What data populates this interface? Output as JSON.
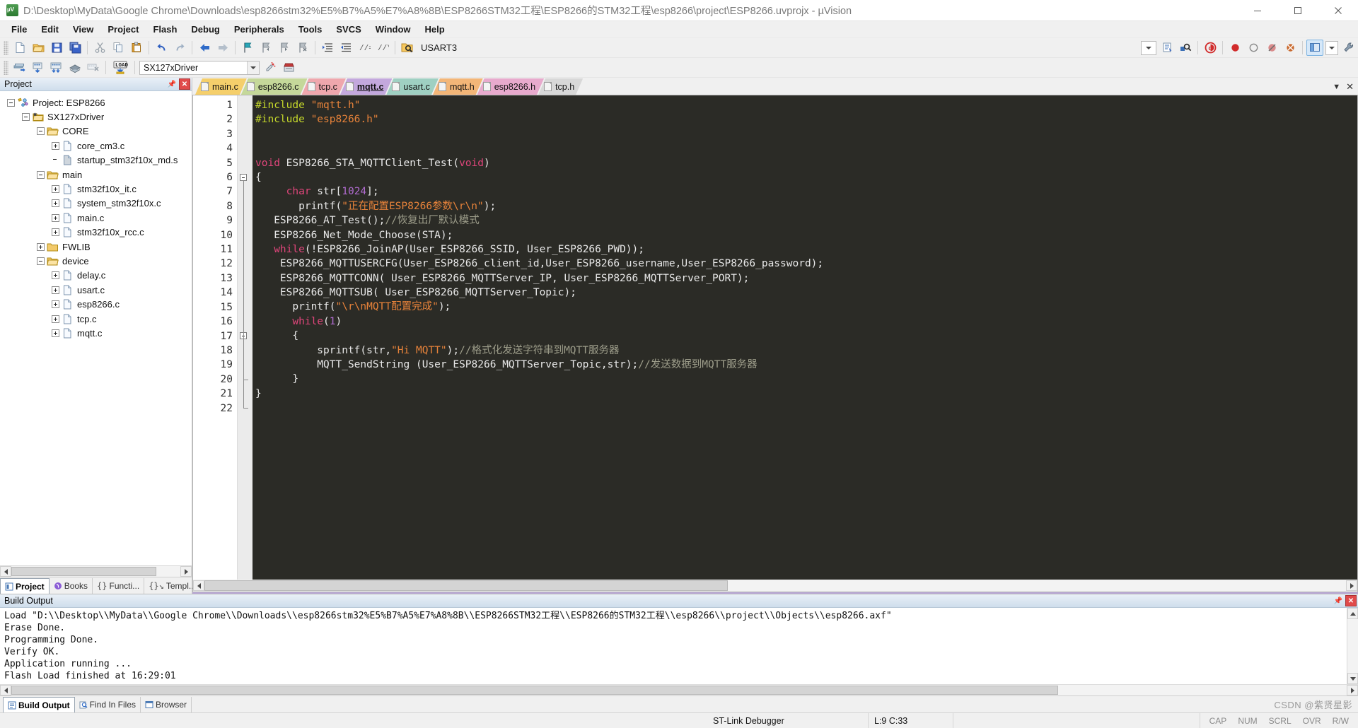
{
  "window": {
    "title": "D:\\Desktop\\MyData\\Google Chrome\\Downloads\\esp8266stm32%E5%B7%A5%E7%A8%8B\\ESP8266STM32工程\\ESP8266的STM32工程\\esp8266\\project\\ESP8266.uvprojx - µVision",
    "app_icon": "uvision-logo",
    "minimize": "─",
    "maximize": "☐",
    "close": "✕"
  },
  "menubar": {
    "items": [
      {
        "label": "File"
      },
      {
        "label": "Edit"
      },
      {
        "label": "View"
      },
      {
        "label": "Project"
      },
      {
        "label": "Flash"
      },
      {
        "label": "Debug"
      },
      {
        "label": "Peripherals"
      },
      {
        "label": "Tools"
      },
      {
        "label": "SVCS"
      },
      {
        "label": "Window"
      },
      {
        "label": "Help"
      }
    ]
  },
  "toolbar_main": {
    "find_combo_value": "USART3",
    "icons": [
      "new-file-icon",
      "open-file-icon",
      "save-icon",
      "save-all-icon",
      "cut-icon",
      "copy-icon",
      "paste-icon",
      "undo-icon",
      "redo-icon",
      "navigate-back-icon",
      "navigate-forward-icon",
      "bookmark-toggle-icon",
      "bookmark-prev-icon",
      "bookmark-next-icon",
      "bookmark-clear-icon",
      "indent-increase-icon",
      "indent-decrease-icon",
      "comment-selection-icon",
      "uncomment-selection-icon",
      "find-in-files-icon",
      "insert-bookmark-icon",
      "show-output-icon",
      "find-icon",
      "debug-session-icon",
      "breakpoint-icon",
      "disable-breakpoint-icon",
      "disable-all-breakpoints-icon",
      "kill-all-breakpoints-icon",
      "window-layout-icon",
      "configure-icon"
    ]
  },
  "toolbar_build": {
    "target_value": "SX127xDriver",
    "icons": [
      "translate-file-icon",
      "build-target-icon",
      "rebuild-all-icon",
      "batch-build-icon",
      "stop-build-icon",
      "download-to-flash-icon",
      "target-options-icon",
      "manage-runtime-icon"
    ],
    "download_label": "LOAD"
  },
  "sidebar": {
    "caption": "Project",
    "caption_buttons": [
      "pin-icon",
      "close-icon"
    ],
    "tree": [
      {
        "label": "Project: ESP8266",
        "depth": 0,
        "expander": "minus",
        "icon": "project-icon"
      },
      {
        "label": "SX127xDriver",
        "depth": 1,
        "expander": "minus",
        "icon": "target-icon"
      },
      {
        "label": "CORE",
        "depth": 2,
        "expander": "minus",
        "icon": "folder-open-icon"
      },
      {
        "label": "core_cm3.c",
        "depth": 3,
        "expander": "plus",
        "icon": "c-file-icon"
      },
      {
        "label": "startup_stm32f10x_md.s",
        "depth": 3,
        "expander": "none",
        "icon": "asm-file-icon"
      },
      {
        "label": "main",
        "depth": 2,
        "expander": "minus",
        "icon": "folder-open-icon"
      },
      {
        "label": "stm32f10x_it.c",
        "depth": 3,
        "expander": "plus",
        "icon": "c-file-icon"
      },
      {
        "label": "system_stm32f10x.c",
        "depth": 3,
        "expander": "plus",
        "icon": "c-file-icon"
      },
      {
        "label": "main.c",
        "depth": 3,
        "expander": "plus",
        "icon": "c-file-icon"
      },
      {
        "label": "stm32f10x_rcc.c",
        "depth": 3,
        "expander": "plus",
        "icon": "c-file-icon"
      },
      {
        "label": "FWLIB",
        "depth": 2,
        "expander": "plus",
        "icon": "folder-closed-icon"
      },
      {
        "label": "device",
        "depth": 2,
        "expander": "minus",
        "icon": "folder-open-icon"
      },
      {
        "label": "delay.c",
        "depth": 3,
        "expander": "plus",
        "icon": "c-file-icon"
      },
      {
        "label": "usart.c",
        "depth": 3,
        "expander": "plus",
        "icon": "c-file-icon"
      },
      {
        "label": "esp8266.c",
        "depth": 3,
        "expander": "plus",
        "icon": "c-file-icon"
      },
      {
        "label": "tcp.c",
        "depth": 3,
        "expander": "plus",
        "icon": "c-file-icon"
      },
      {
        "label": "mqtt.c",
        "depth": 3,
        "expander": "plus",
        "icon": "c-file-icon"
      }
    ],
    "tabs": [
      {
        "label": "Project",
        "icon": "project-tab-icon",
        "active": true
      },
      {
        "label": "Books",
        "icon": "books-icon",
        "active": false
      },
      {
        "label": "Functi...",
        "icon": "functions-icon",
        "active": false
      },
      {
        "label": "Templ...",
        "icon": "templates-icon",
        "active": false
      }
    ]
  },
  "editor": {
    "tabs": [
      {
        "label": "main.c",
        "color": "#f5cf6b",
        "active": false
      },
      {
        "label": "esp8266.c",
        "color": "#c5d89a",
        "active": false
      },
      {
        "label": "tcp.c",
        "color": "#efa7ad",
        "active": false
      },
      {
        "label": "mqtt.c",
        "color": "#c3a8dd",
        "active": true
      },
      {
        "label": "usart.c",
        "color": "#9fd0c2",
        "active": false
      },
      {
        "label": "mqtt.h",
        "color": "#f3b678",
        "active": false
      },
      {
        "label": "esp8266.h",
        "color": "#e8aacd",
        "active": false
      },
      {
        "label": "tcp.h",
        "color": "#d8d8d8",
        "active": false
      }
    ],
    "tab_controls": [
      "tabstrip-menu-icon",
      "tabstrip-close-icon"
    ],
    "line_numbers": [
      1,
      2,
      3,
      4,
      5,
      6,
      7,
      8,
      9,
      10,
      11,
      12,
      13,
      14,
      15,
      16,
      17,
      18,
      19,
      20,
      21,
      22
    ],
    "lines": [
      {
        "n": 1,
        "tokens": [
          {
            "t": "#include ",
            "c": "pre"
          },
          {
            "t": "\"mqtt.h\"",
            "c": "str"
          }
        ]
      },
      {
        "n": 2,
        "tokens": [
          {
            "t": "#include ",
            "c": "pre"
          },
          {
            "t": "\"esp8266.h\"",
            "c": "str"
          }
        ]
      },
      {
        "n": 3,
        "tokens": []
      },
      {
        "n": 4,
        "tokens": []
      },
      {
        "n": 5,
        "tokens": [
          {
            "t": "void",
            "c": "kw"
          },
          {
            "t": " ESP8266_STA_MQTTClient_Test(",
            "c": "plain"
          },
          {
            "t": "void",
            "c": "kw"
          },
          {
            "t": ")",
            "c": "plain"
          }
        ]
      },
      {
        "n": 6,
        "tokens": [
          {
            "t": "{",
            "c": "plain"
          }
        ]
      },
      {
        "n": 7,
        "tokens": [
          {
            "t": "     ",
            "c": "plain"
          },
          {
            "t": "char",
            "c": "kw"
          },
          {
            "t": " str[",
            "c": "plain"
          },
          {
            "t": "1024",
            "c": "num"
          },
          {
            "t": "];",
            "c": "plain"
          }
        ]
      },
      {
        "n": 8,
        "tokens": [
          {
            "t": "       printf(",
            "c": "plain"
          },
          {
            "t": "\"正在配置ESP8266参数\\r\\n\"",
            "c": "str"
          },
          {
            "t": ");",
            "c": "plain"
          }
        ]
      },
      {
        "n": 9,
        "tokens": [
          {
            "t": "   ESP8266_AT_Test();",
            "c": "plain"
          },
          {
            "t": "//恢复出厂默认模式",
            "c": "cmt"
          }
        ]
      },
      {
        "n": 10,
        "tokens": [
          {
            "t": "   ESP8266_Net_Mode_Choose(STA);",
            "c": "plain"
          }
        ]
      },
      {
        "n": 11,
        "tokens": [
          {
            "t": "   ",
            "c": "plain"
          },
          {
            "t": "while",
            "c": "kw"
          },
          {
            "t": "(!ESP8266_JoinAP(User_ESP8266_SSID, User_ESP8266_PWD));",
            "c": "plain"
          }
        ]
      },
      {
        "n": 12,
        "tokens": [
          {
            "t": "    ESP8266_MQTTUSERCFG(User_ESP8266_client_id,User_ESP8266_username,User_ESP8266_password);",
            "c": "plain"
          }
        ]
      },
      {
        "n": 13,
        "tokens": [
          {
            "t": "    ESP8266_MQTTCONN( User_ESP8266_MQTTServer_IP, User_ESP8266_MQTTServer_PORT);",
            "c": "plain"
          }
        ]
      },
      {
        "n": 14,
        "tokens": [
          {
            "t": "    ESP8266_MQTTSUB( User_ESP8266_MQTTServer_Topic);",
            "c": "plain"
          }
        ]
      },
      {
        "n": 15,
        "tokens": [
          {
            "t": "      printf(",
            "c": "plain"
          },
          {
            "t": "\"\\r\\nMQTT配置完成\"",
            "c": "str"
          },
          {
            "t": ");",
            "c": "plain"
          }
        ]
      },
      {
        "n": 16,
        "tokens": [
          {
            "t": "      ",
            "c": "plain"
          },
          {
            "t": "while",
            "c": "kw"
          },
          {
            "t": "(",
            "c": "plain"
          },
          {
            "t": "1",
            "c": "num"
          },
          {
            "t": ")",
            "c": "plain"
          }
        ]
      },
      {
        "n": 17,
        "tokens": [
          {
            "t": "      {",
            "c": "plain"
          }
        ]
      },
      {
        "n": 18,
        "tokens": [
          {
            "t": "          sprintf(str,",
            "c": "plain"
          },
          {
            "t": "\"Hi MQTT\"",
            "c": "str"
          },
          {
            "t": ");",
            "c": "plain"
          },
          {
            "t": "//格式化发送字符串到MQTT服务器",
            "c": "cmt"
          }
        ]
      },
      {
        "n": 19,
        "tokens": [
          {
            "t": "          MQTT_SendString (User_ESP8266_MQTTServer_Topic,str);",
            "c": "plain"
          },
          {
            "t": "//发送数据到MQTT服务器",
            "c": "cmt"
          }
        ]
      },
      {
        "n": 20,
        "tokens": [
          {
            "t": "      }",
            "c": "plain"
          }
        ]
      },
      {
        "n": 21,
        "tokens": [
          {
            "t": "}",
            "c": "plain"
          }
        ]
      },
      {
        "n": 22,
        "tokens": []
      }
    ],
    "fold_lines": [
      6,
      17
    ]
  },
  "build_output": {
    "caption": "Build Output",
    "caption_buttons": [
      "pin-icon",
      "close-icon"
    ],
    "text": "Load \"D:\\\\Desktop\\\\MyData\\\\Google Chrome\\\\Downloads\\\\esp8266stm32%E5%B7%A5%E7%A8%8B\\\\ESP8266STM32工程\\\\ESP8266的STM32工程\\\\esp8266\\\\project\\\\Objects\\\\esp8266.axf\"\nErase Done.\nProgramming Done.\nVerify OK.\nApplication running ...\nFlash Load finished at 16:29:01",
    "tabs": [
      {
        "label": "Build Output",
        "icon": "build-output-icon",
        "active": true
      },
      {
        "label": "Find In Files",
        "icon": "find-in-files-icon",
        "active": false
      },
      {
        "label": "Browser",
        "icon": "browser-icon",
        "active": false
      }
    ]
  },
  "statusbar": {
    "debugger": "ST-Link Debugger",
    "cursor": "L:9 C:33",
    "indicators": [
      "CAP",
      "NUM",
      "SCRL",
      "OVR",
      "R/W"
    ],
    "watermark": "CSDN @紫贤星影"
  }
}
